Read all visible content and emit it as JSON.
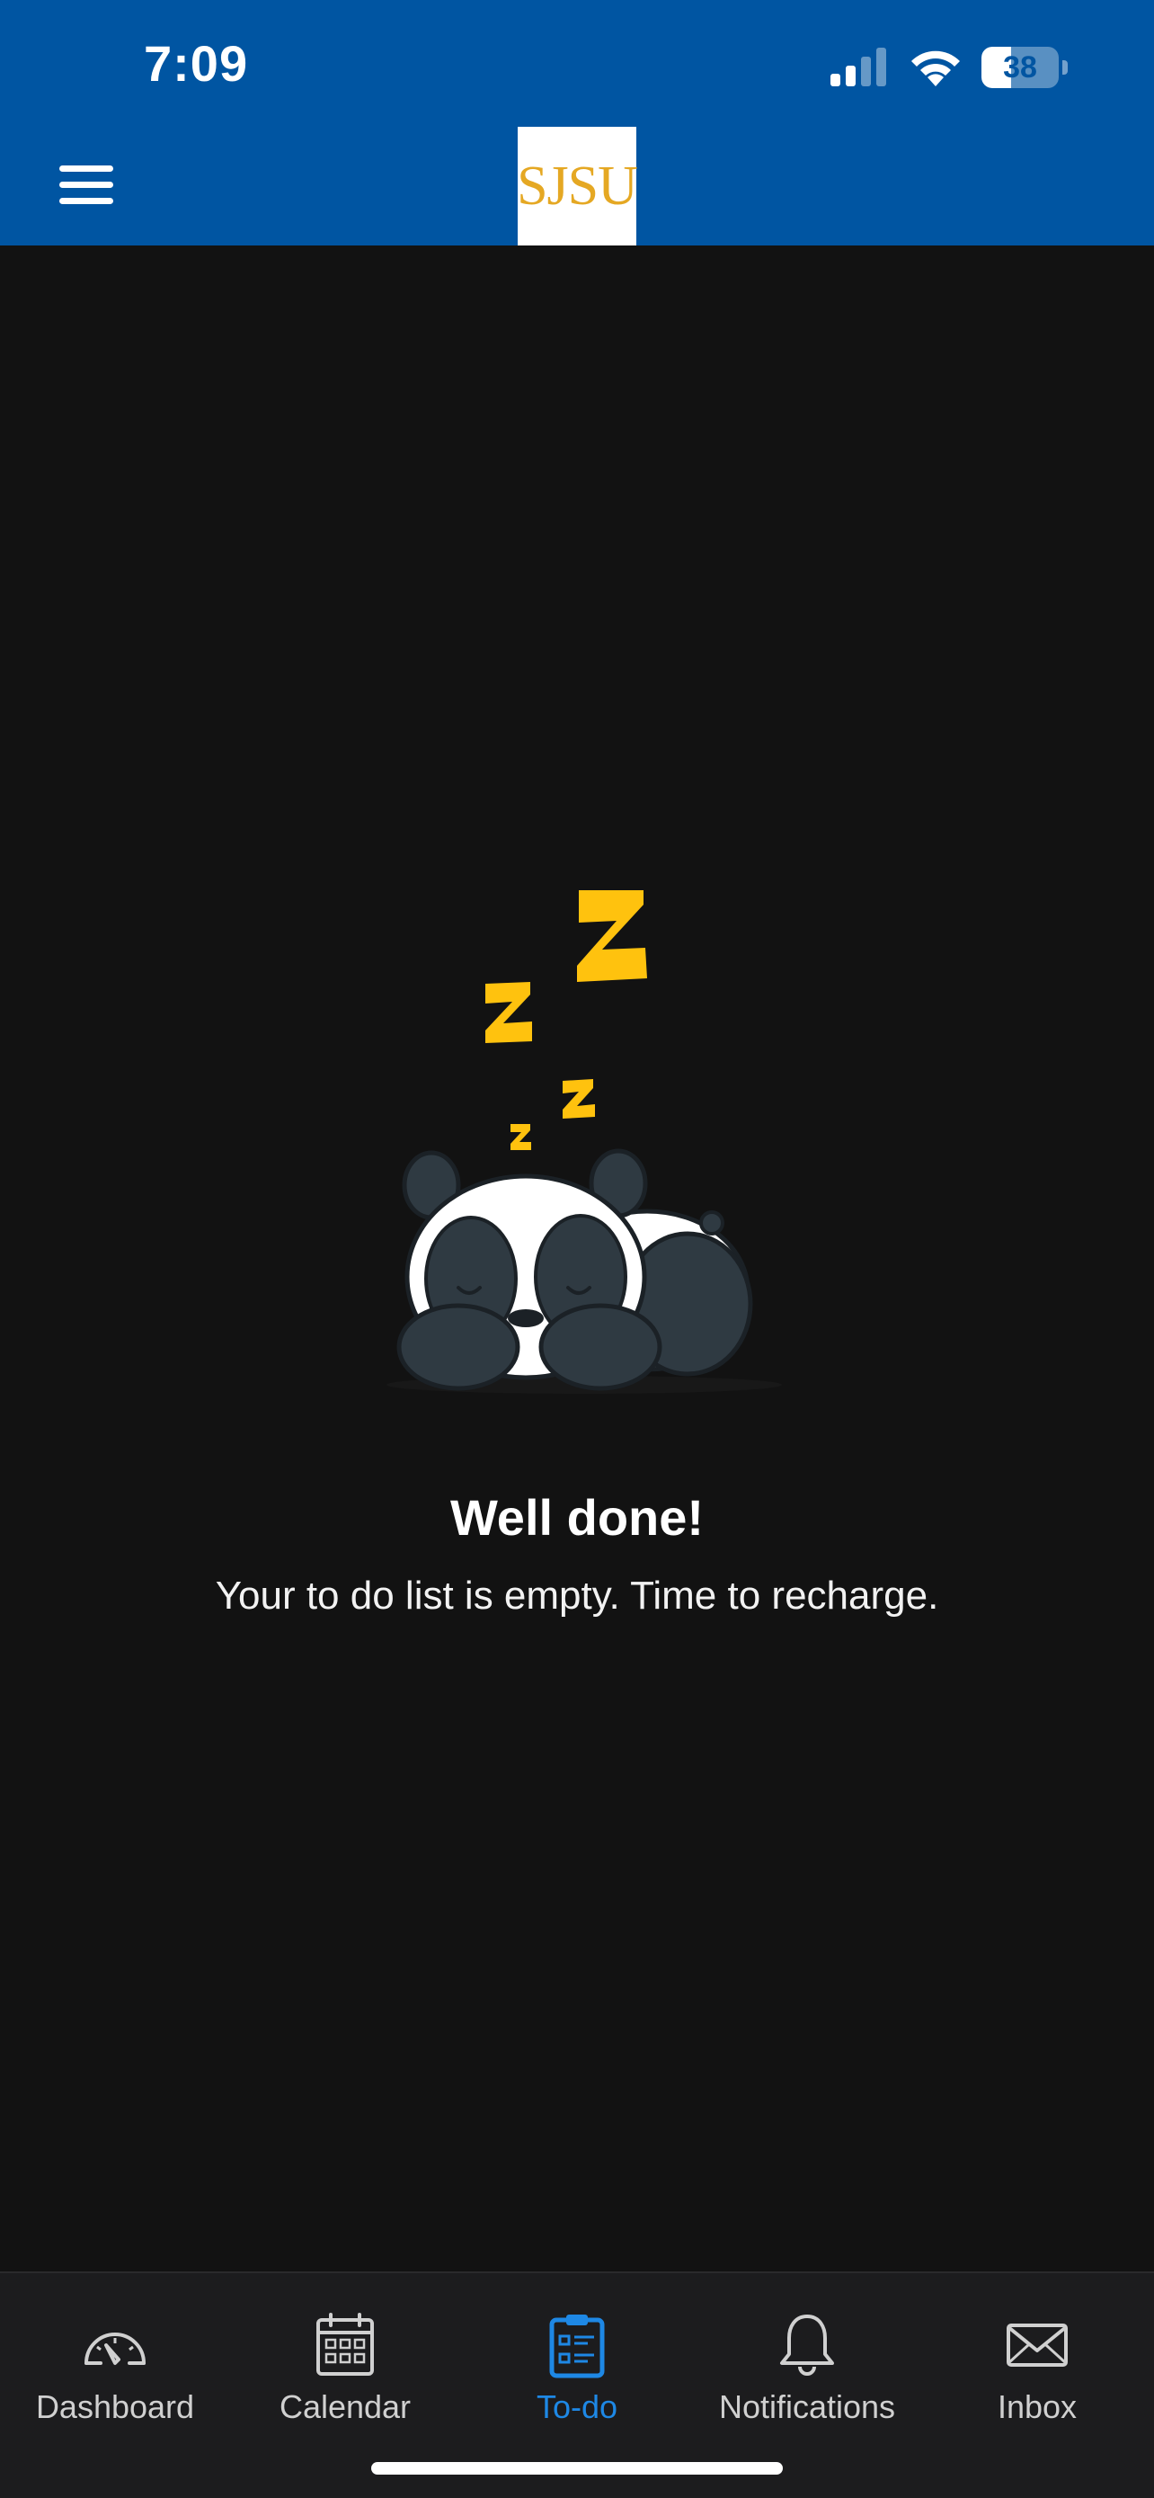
{
  "status_bar": {
    "time": "7:09",
    "battery_level": "38",
    "battery_fraction": 0.38
  },
  "header": {
    "logo_text": "SJSU",
    "menu_icon": "hamburger-menu-icon",
    "brand_color": "#0055A2",
    "logo_color": "#E5A823"
  },
  "empty_state": {
    "illustration": "sleeping-panda-illustration",
    "title": "Well done!",
    "subtitle": "Your to do list is empty. Time to recharge."
  },
  "bottom_nav": {
    "active_color": "#1E88E5",
    "items": [
      {
        "label": "Dashboard",
        "icon": "dashboard-gauge-icon",
        "active": false
      },
      {
        "label": "Calendar",
        "icon": "calendar-icon",
        "active": false
      },
      {
        "label": "To-do",
        "icon": "clipboard-checklist-icon",
        "active": true
      },
      {
        "label": "Notifications",
        "icon": "bell-icon",
        "active": false
      },
      {
        "label": "Inbox",
        "icon": "envelope-icon",
        "active": false
      }
    ]
  }
}
